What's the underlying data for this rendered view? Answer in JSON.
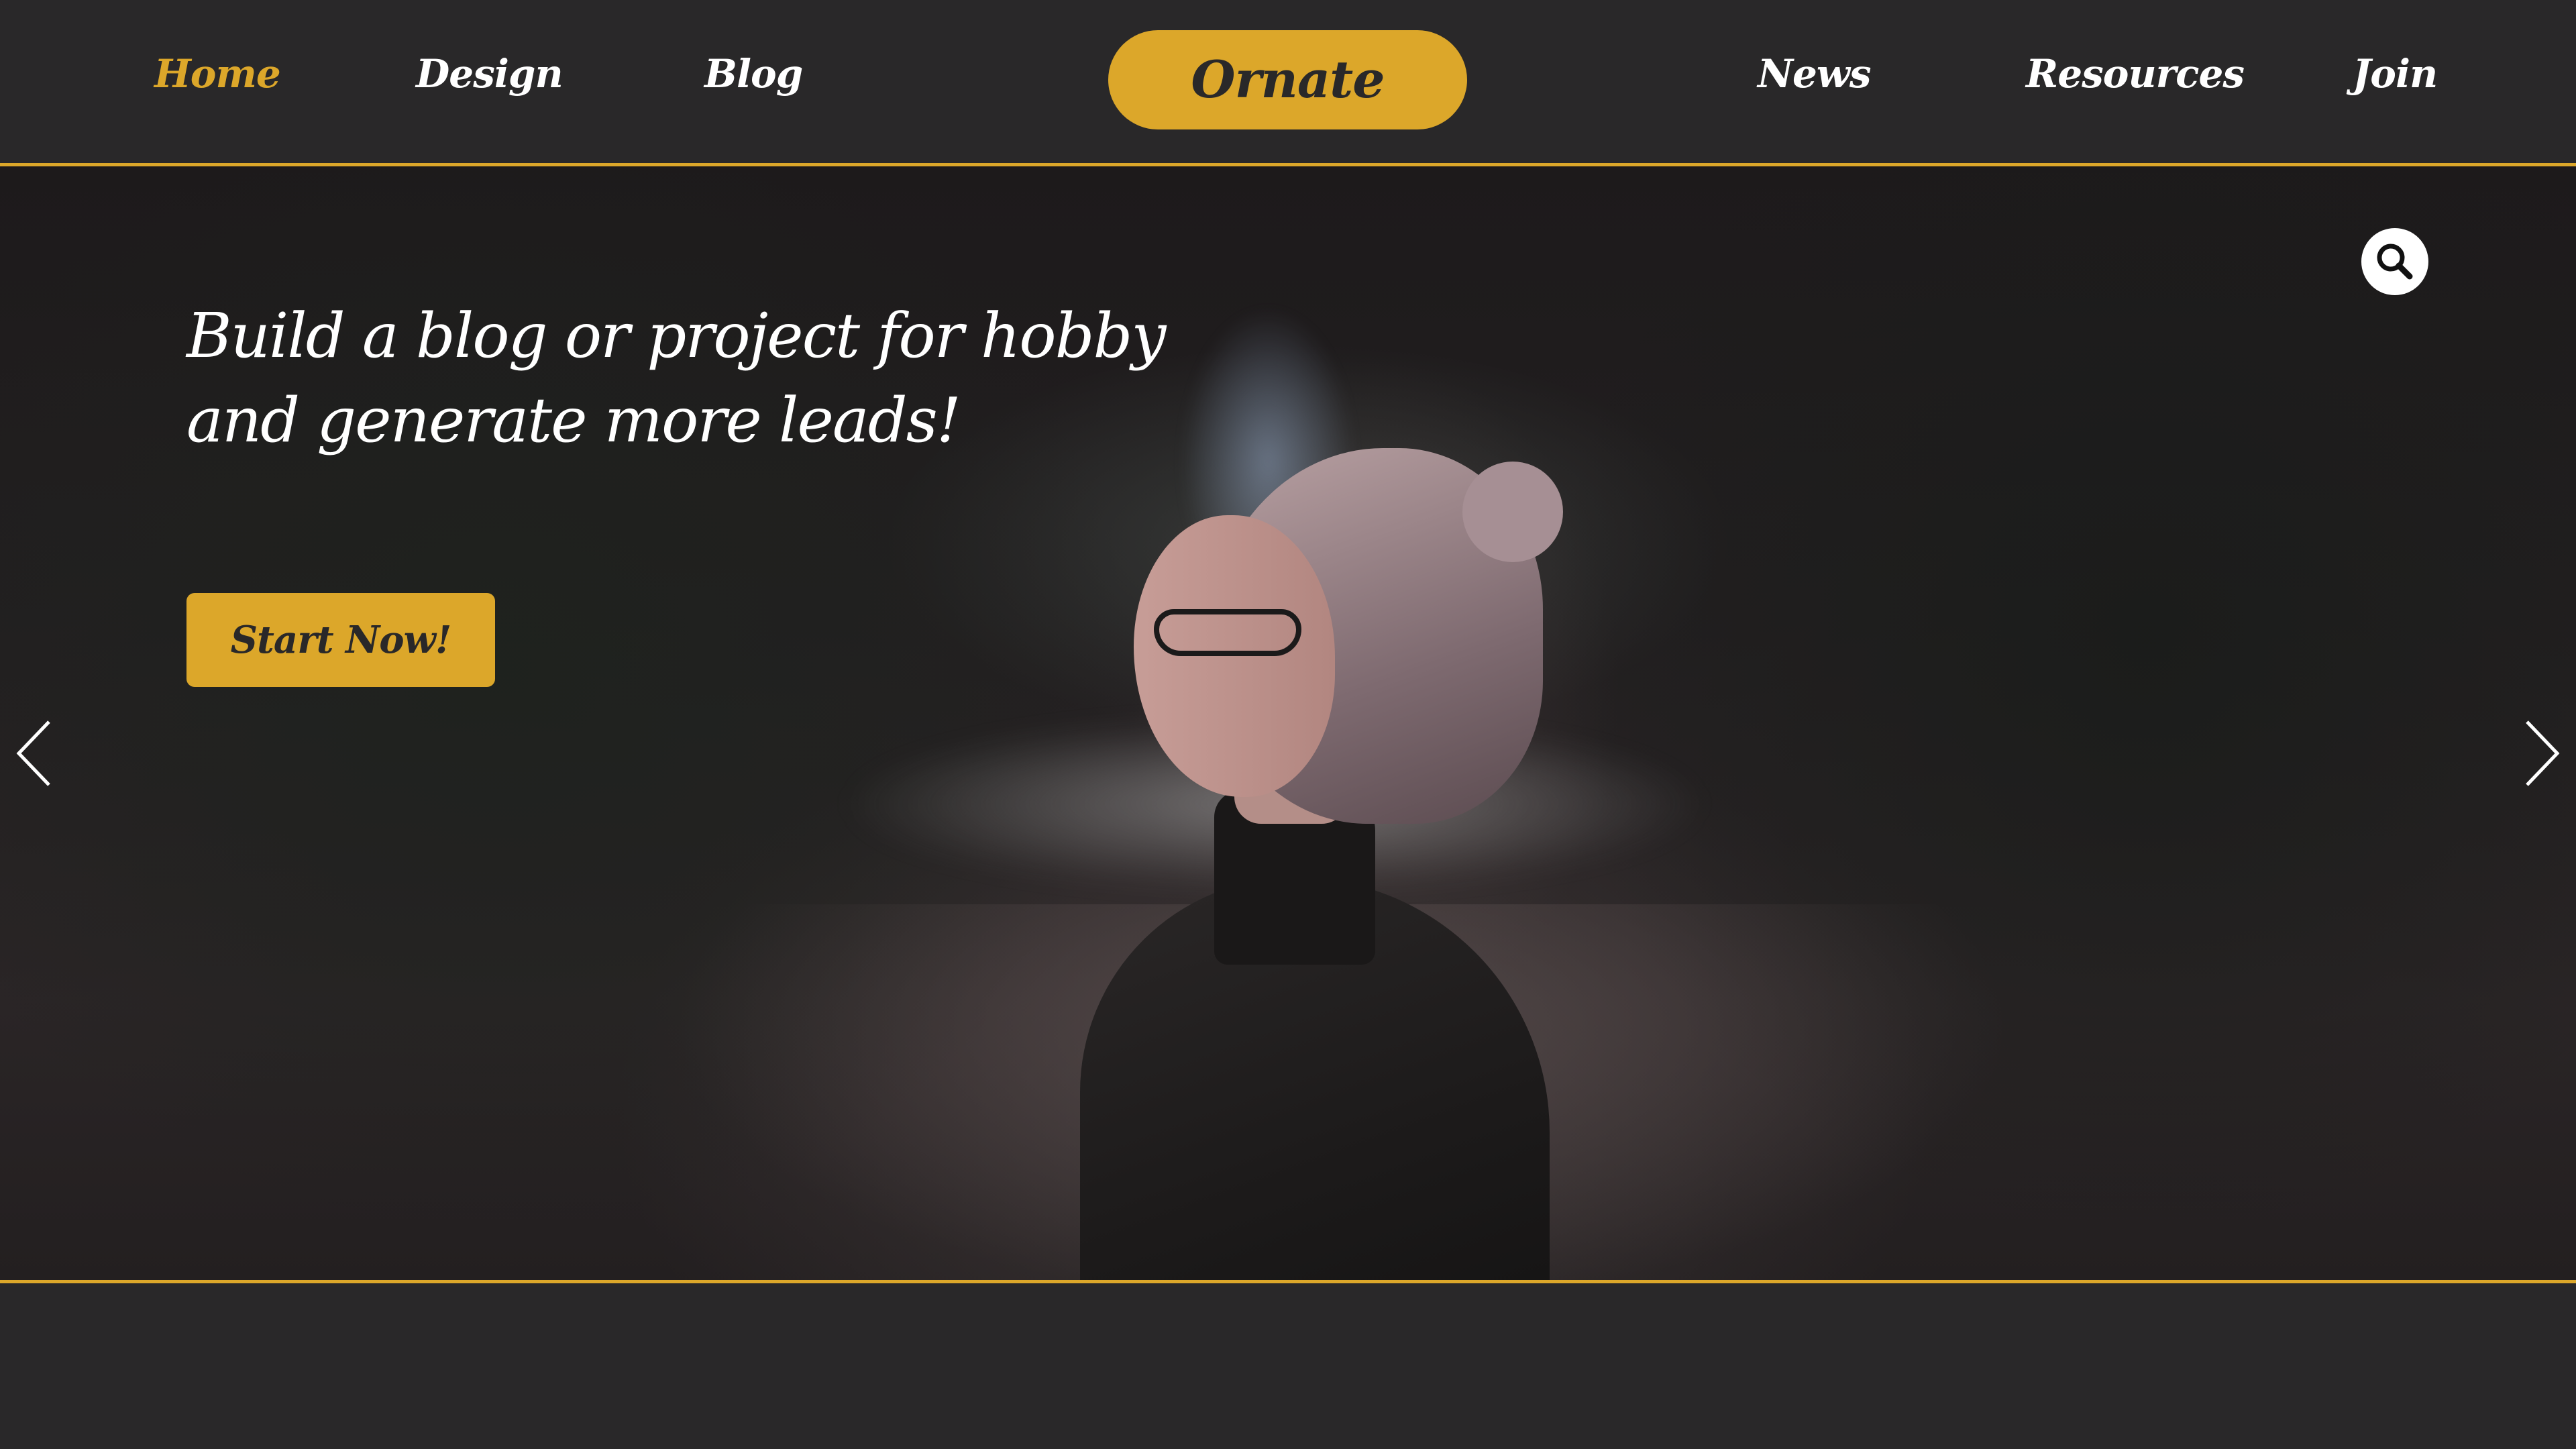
{
  "nav": {
    "items": [
      {
        "label": "Home",
        "active": true
      },
      {
        "label": "Design",
        "active": false
      },
      {
        "label": "Blog",
        "active": false
      },
      {
        "label": "News",
        "active": false
      },
      {
        "label": "Resources",
        "active": false
      },
      {
        "label": "Join",
        "active": false
      }
    ],
    "logo": "Ornate"
  },
  "hero": {
    "headline": "Build a blog or project for hobby and generate more leads!",
    "cta_label": "Start Now!",
    "search_icon": "search-icon",
    "prev_icon": "chevron-left-icon",
    "next_icon": "chevron-right-icon"
  },
  "colors": {
    "background": "#292829",
    "accent": "#dca72a",
    "text": "#ffffff"
  }
}
